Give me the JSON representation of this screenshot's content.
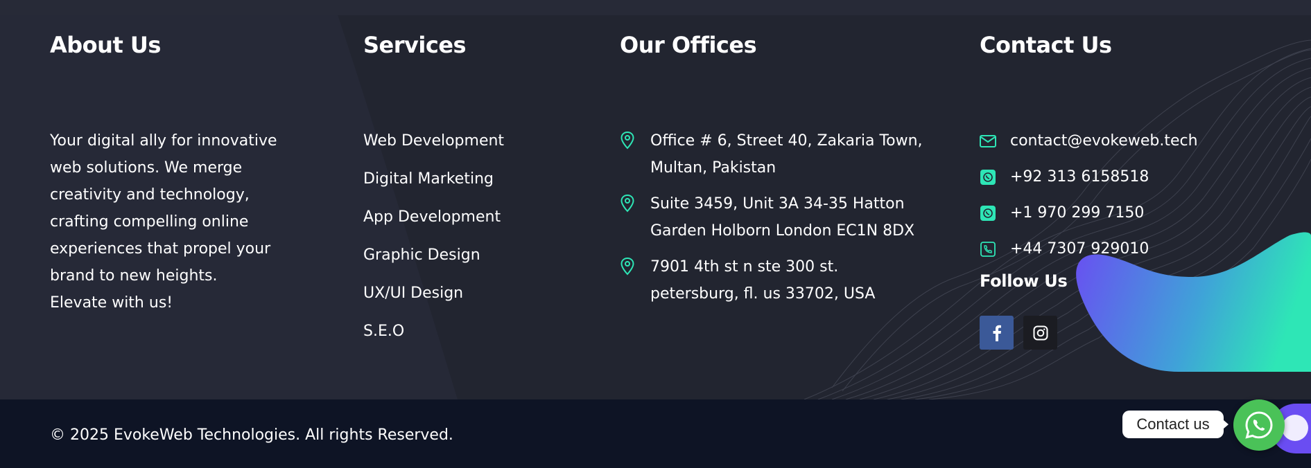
{
  "about": {
    "title": "About Us",
    "text": "Your digital ally for innovative web solutions. We merge creativity and technology, crafting compelling online experiences that propel your brand to new heights. Elevate with us!"
  },
  "services": {
    "title": "Services",
    "items": [
      "Web Development",
      "Digital Marketing",
      "App Development",
      "Graphic Design",
      "UX/UI Design",
      "S.E.O"
    ]
  },
  "offices": {
    "title": "Our Offices",
    "items": [
      "Office # 6, Street 40, Zakaria Town, Multan, Pakistan",
      "Suite 3459, Unit 3A 34-35 Hatton Garden Holborn London EC1N 8DX",
      "7901 4th st n ste 300 st. petersburg, fl. us 33702, USA"
    ]
  },
  "contact": {
    "title": "Contact Us",
    "email": "contact@evokeweb.tech",
    "phones": [
      "+92 313 6158518",
      "+1 970 299 7150",
      "+44 7307 929010"
    ],
    "follow_title": "Follow Us",
    "social": [
      "facebook-icon",
      "instagram-icon"
    ]
  },
  "footer": {
    "copyright": "© 2025 EvokeWeb Technologies. All rights Reserved."
  },
  "chat": {
    "label": "Contact us"
  },
  "colors": {
    "accent": "#2ee6b6",
    "background": "#222530",
    "footer_bg": "#0e1425",
    "facebook": "#3b5998",
    "whatsapp": "#4ac258",
    "purple": "#6a4df2"
  }
}
